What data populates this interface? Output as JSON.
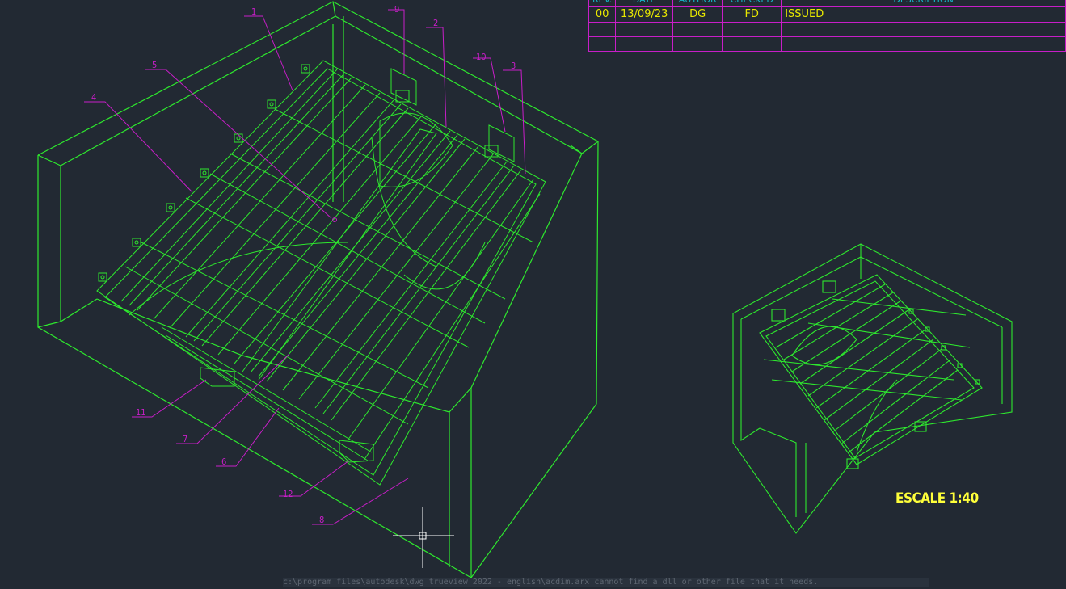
{
  "revision_table": {
    "headers": [
      "REV.",
      "DATE",
      "AUTHOR",
      "CHECKED",
      "DESCRIPTION"
    ],
    "rows": [
      {
        "rev": "00",
        "date": "13/09/23",
        "author": "DG",
        "checked": "FD",
        "description": "ISSUED"
      }
    ]
  },
  "scale_label": "ESCALE 1:40",
  "callouts": [
    "1",
    "2",
    "3",
    "4",
    "5",
    "6",
    "7",
    "8",
    "9",
    "10",
    "11",
    "12"
  ],
  "command_line": "c:\\program files\\autodesk\\dwg trueview 2022 - english\\acdim.arx cannot find a dll or other file that it needs.",
  "colors": {
    "background": "#222933",
    "geometry": "#2ee82e",
    "leaders": "#c81ec8",
    "text": "#e8e800",
    "header_text": "#17b6c9",
    "crosshair": "#ffffff"
  }
}
